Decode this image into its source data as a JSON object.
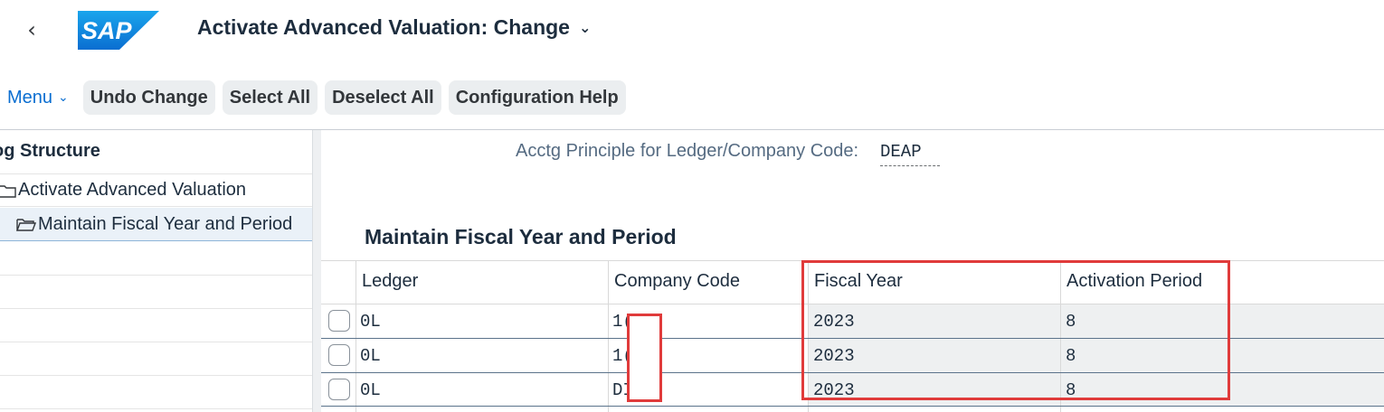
{
  "shell": {
    "back_icon": "chevron-left-icon",
    "logo_text": "SAP",
    "title": "Activate Advanced Valuation: Change"
  },
  "toolbar": {
    "menu_label": "Menu",
    "buttons": [
      "Undo Change",
      "Select All",
      "Deselect All",
      "Configuration Help"
    ]
  },
  "tree": {
    "header": "og Structure",
    "items": [
      "Activate Advanced Valuation",
      "Maintain Fiscal Year and Period"
    ]
  },
  "main": {
    "acctg_label": "Acctg Principle for Ledger/Company Code:",
    "acctg_value": "DEAP",
    "section_title": "Maintain Fiscal Year and Period",
    "columns": [
      "Ledger",
      "Company Code",
      "Fiscal Year",
      "Activation Period"
    ],
    "rows": [
      {
        "ledger": "0L",
        "company_code": "1(",
        "fiscal_year": "2023",
        "activation_period": "8"
      },
      {
        "ledger": "0L",
        "company_code": "1(",
        "fiscal_year": "2023",
        "activation_period": "8"
      },
      {
        "ledger": "0L",
        "company_code": "DI",
        "fiscal_year": "2023",
        "activation_period": "8"
      }
    ]
  },
  "colors": {
    "accent": "#0a6ed1",
    "highlight_box": "#e03b3b",
    "logo_blue": "#0a6ed1"
  }
}
